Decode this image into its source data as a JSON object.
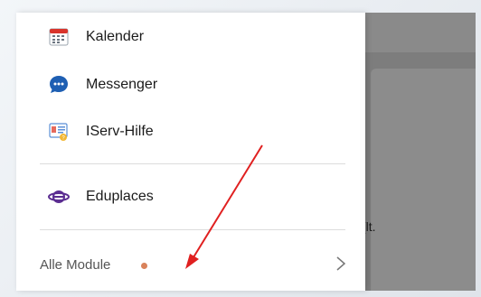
{
  "menu": {
    "items": [
      {
        "label": "Kalender",
        "icon": "calendar-icon"
      },
      {
        "label": "Messenger",
        "icon": "messenger-icon"
      },
      {
        "label": "IServ-Hilfe",
        "icon": "help-icon"
      },
      {
        "label": "Eduplaces",
        "icon": "eduplaces-icon"
      }
    ],
    "all_modules_label": "Alle Module",
    "all_modules_badge_color": "#d9825b"
  },
  "background": {
    "partial_text": "(lt."
  },
  "annotation": {
    "arrow_color": "#e02020"
  }
}
